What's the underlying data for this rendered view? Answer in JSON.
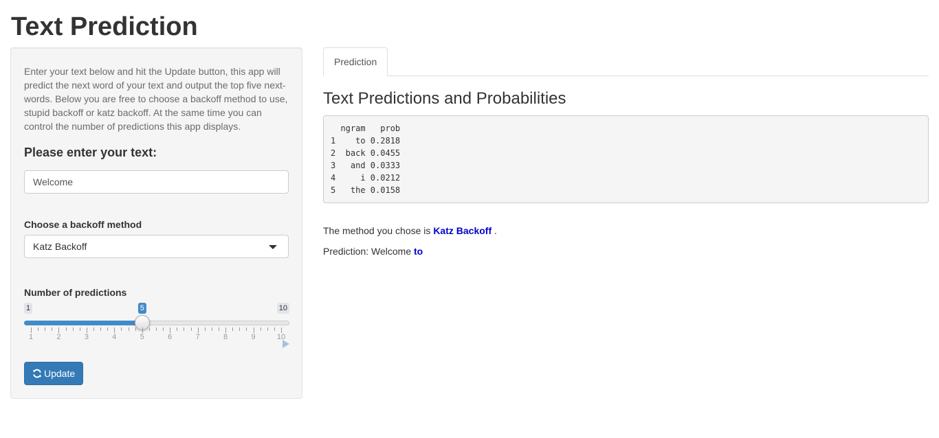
{
  "page": {
    "title": "Text Prediction"
  },
  "sidebar": {
    "intro": "Enter your text below and hit the Update button, this app will predict the next word of your text and output the top five next-words. Below you are free to choose a backoff method to use, stupid backoff or katz backoff. At the same time you can control the number of predictions this app displays.",
    "text_label": "Please enter your text:",
    "text_value": "Welcome",
    "backoff_label": "Choose a backoff method",
    "backoff_selected": "Katz Backoff",
    "npred_label": "Number of predictions",
    "slider": {
      "min": 1,
      "max": 10,
      "value": 5,
      "min_label": "1",
      "max_label": "10",
      "value_label": "5",
      "ticks": [
        "1",
        "2",
        "3",
        "4",
        "5",
        "6",
        "7",
        "8",
        "9",
        "10"
      ]
    },
    "update_label": "Update",
    "accent_color": "#428bca"
  },
  "main": {
    "tab_label": "Prediction",
    "section_title": "Text Predictions and Probabilities",
    "output_lines": [
      "  ngram   prob",
      "1    to 0.2818",
      "2  back 0.0455",
      "3   and 0.0333",
      "4     i 0.0212",
      "5   the 0.0158"
    ],
    "method_prefix": "The method you chose is ",
    "method_value": "Katz Backoff",
    "method_suffix": " .",
    "prediction_prefix": "Prediction: Welcome ",
    "prediction_value": "to",
    "highlight_color": "#0000cc"
  }
}
